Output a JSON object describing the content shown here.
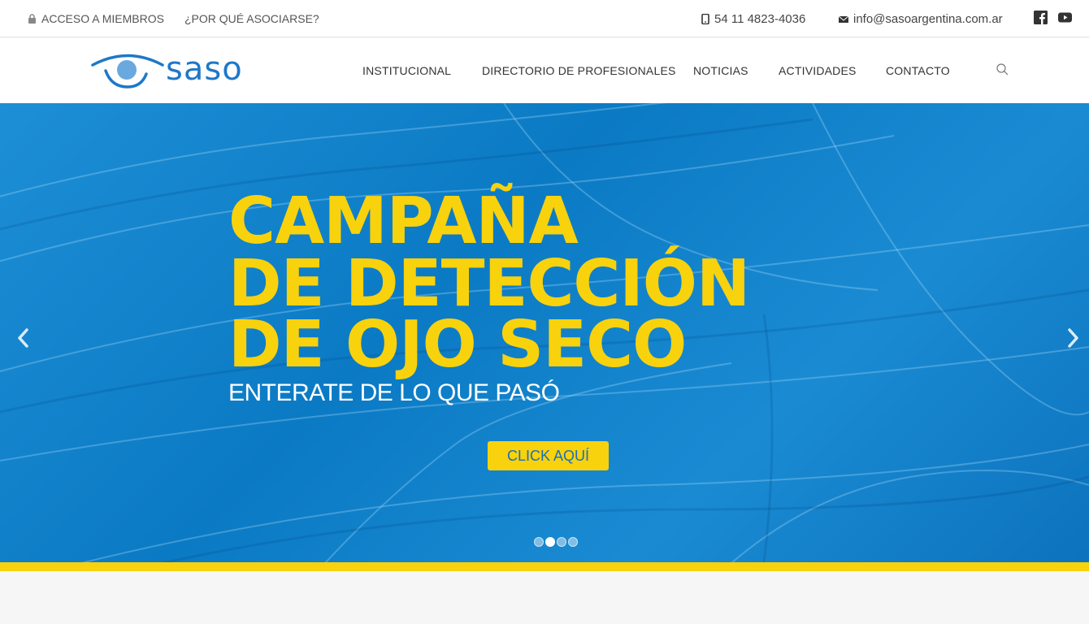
{
  "topbar": {
    "members_label": "ACCESO A MIEMBROS",
    "why_join_label": "¿POR QUÉ ASOCIARSE?",
    "phone": "54 11 4823-4036",
    "email": "info@sasoargentina.com.ar",
    "icons": [
      "lock-icon",
      "phone-icon",
      "mail-icon",
      "facebook-icon",
      "youtube-icon"
    ]
  },
  "header": {
    "logo_text": "saso",
    "nav": [
      "INSTITUCIONAL",
      "DIRECTORIO DE PROFESIONALES",
      "NOTICIAS",
      "ACTIVIDADES",
      "CONTACTO"
    ],
    "search_icon": "search-icon"
  },
  "hero": {
    "title_lines": [
      "CAMPAÑA",
      "DE DETECCIÓN",
      "DE OJO SECO"
    ],
    "subtitle": "ENTERATE DE LO QUE PASÓ",
    "cta_label": "CLICK AQUÍ",
    "slides_count": 4,
    "active_slide": 2
  },
  "colors": {
    "brand_blue": "#1e78c8",
    "hero_blue": "#1588d2",
    "accent_yellow": "#f8d20d",
    "text_dark": "#333333"
  }
}
